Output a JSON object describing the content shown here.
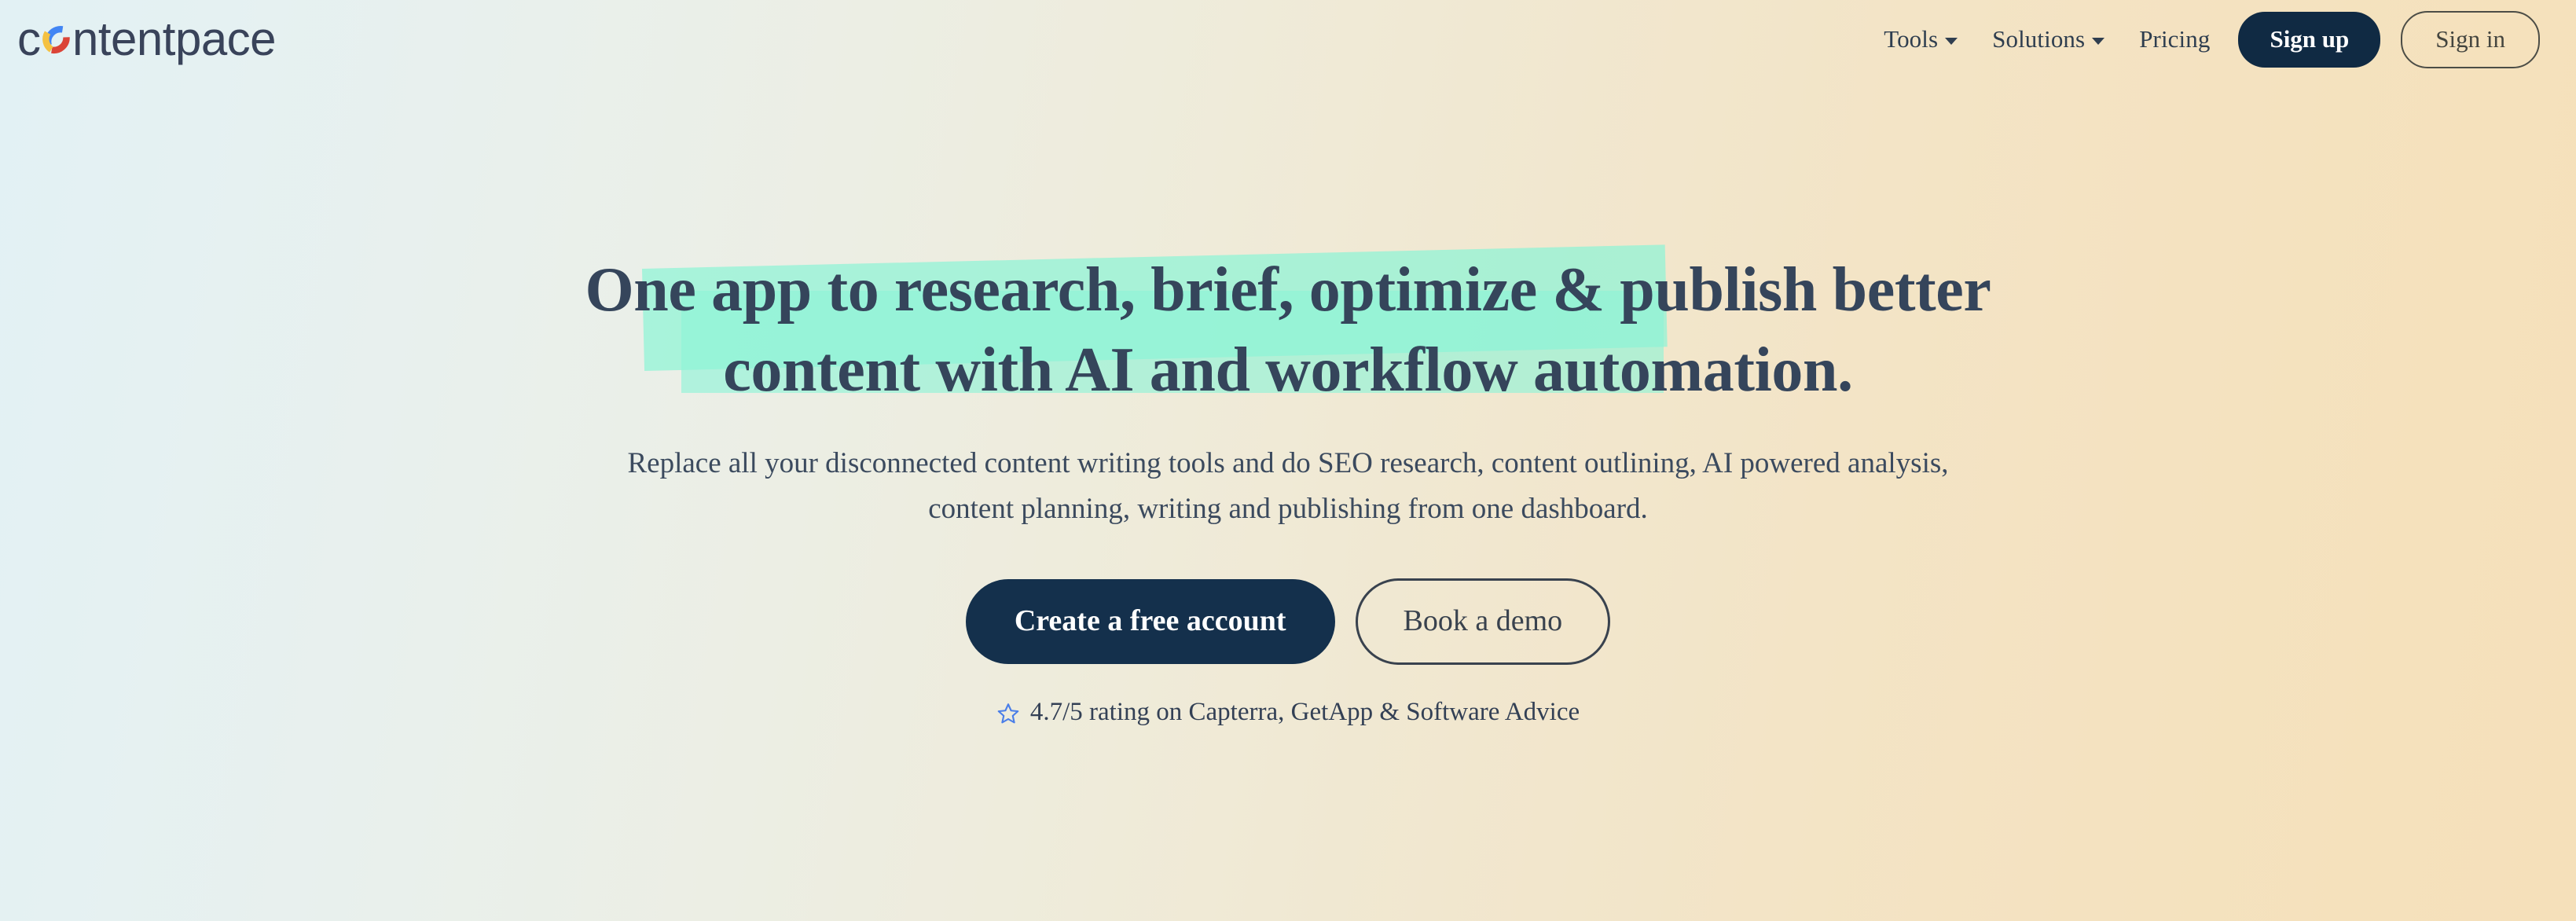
{
  "brand": {
    "name": "contentpace",
    "text_before_o": "c",
    "text_after_o": "ntentpace",
    "ring_colors": {
      "blue": "#4285F4",
      "yellow": "#F4C142",
      "red": "#DB4437"
    },
    "wordmark_color": "#39435a"
  },
  "nav": {
    "links": [
      {
        "label": "Tools",
        "has_caret": true
      },
      {
        "label": "Solutions",
        "has_caret": true
      },
      {
        "label": "Pricing",
        "has_caret": false
      }
    ],
    "signup_label": "Sign up",
    "signin_label": "Sign in",
    "signup_bg": "#102a43",
    "signin_border": "#4c4d46"
  },
  "hero": {
    "headline_part_1": "One app to ",
    "headline_highlight": "research, brief, optimize & publish",
    "headline_part_2": " better",
    "headline_line_2": "content with AI and workflow automation.",
    "highlight_color": "#8df4d6",
    "subheadline_line_1": "Replace all your disconnected content writing tools and do SEO research, content outlining, AI",
    "subheadline_line_2": "powered analysis, content planning, writing and publishing from one dashboard.",
    "primary_cta": "Create a free account",
    "secondary_cta": "Book a demo",
    "rating_icon": "star-outline-icon",
    "rating_icon_color": "#4a7ee8",
    "rating_text": "4.7/5 rating on Capterra, GetApp & Software Advice"
  },
  "background": {
    "gradient_start": "#e2f1f4",
    "gradient_end": "#f5e0ba"
  }
}
